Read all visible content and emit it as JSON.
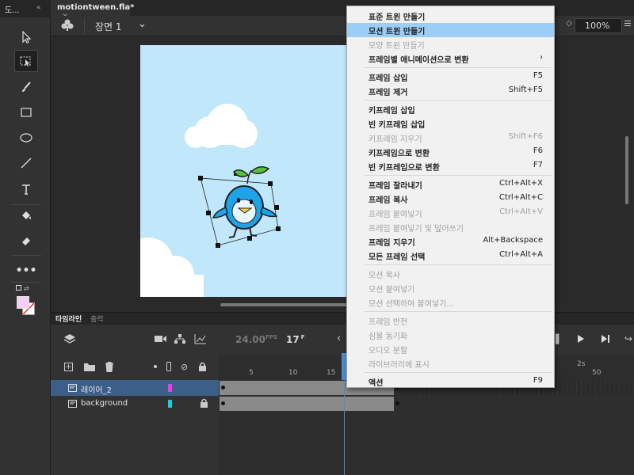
{
  "toolbar": {
    "panel_label": "도..."
  },
  "document": {
    "tab_title": "motiontween.fla*",
    "scene_label": "장면 1",
    "zoom": "100%"
  },
  "panels": {
    "tab_timeline": "타임라인",
    "tab_output": "출력"
  },
  "timeline": {
    "fps": "24.00",
    "fps_unit": "FPS",
    "current_frame": "17",
    "frame_unit": "F",
    "ruler": [
      "5",
      "10",
      "15",
      "2s",
      "50"
    ],
    "layers": [
      {
        "name": "레이어_2",
        "color": "#e442e4",
        "selected": true
      },
      {
        "name": "background",
        "color": "#1ccfe0",
        "selected": false
      }
    ]
  },
  "context_menu": {
    "items": [
      {
        "label": "표준 트윈 만들기",
        "shortcut": "",
        "disabled": false,
        "highlighted": false
      },
      {
        "label": "모션 트윈 만들기",
        "shortcut": "",
        "disabled": false,
        "highlighted": true
      },
      {
        "label": "모양 트윈 만들기",
        "shortcut": "",
        "disabled": true,
        "highlighted": false
      },
      {
        "label": "프레임별 애니메이션으로 변환",
        "shortcut": "›",
        "disabled": false,
        "highlighted": false,
        "sep_after": true
      },
      {
        "label": "프레임 삽입",
        "shortcut": "F5",
        "disabled": false,
        "highlighted": false
      },
      {
        "label": "프레임 제거",
        "shortcut": "Shift+F5",
        "disabled": false,
        "highlighted": false,
        "sep_after": true
      },
      {
        "label": "키프레임 삽입",
        "shortcut": "",
        "disabled": false,
        "highlighted": false
      },
      {
        "label": "빈 키프레임 삽입",
        "shortcut": "",
        "disabled": false,
        "highlighted": false
      },
      {
        "label": "키프레임 지우기",
        "shortcut": "Shift+F6",
        "disabled": true,
        "highlighted": false
      },
      {
        "label": "키프레임으로 변환",
        "shortcut": "F6",
        "disabled": false,
        "highlighted": false
      },
      {
        "label": "빈 키프레임으로 변환",
        "shortcut": "F7",
        "disabled": false,
        "highlighted": false,
        "sep_after": true
      },
      {
        "label": "프레임 잘라내기",
        "shortcut": "Ctrl+Alt+X",
        "disabled": false,
        "highlighted": false
      },
      {
        "label": "프레임 복사",
        "shortcut": "Ctrl+Alt+C",
        "disabled": false,
        "highlighted": false
      },
      {
        "label": "프레임 붙여넣기",
        "shortcut": "Ctrl+Alt+V",
        "disabled": true,
        "highlighted": false
      },
      {
        "label": "프레임 붙여넣기 및 덮어쓰기",
        "shortcut": "",
        "disabled": true,
        "highlighted": false
      },
      {
        "label": "프레임 지우기",
        "shortcut": "Alt+Backspace",
        "disabled": false,
        "highlighted": false
      },
      {
        "label": "모든 프레임 선택",
        "shortcut": "Ctrl+Alt+A",
        "disabled": false,
        "highlighted": false,
        "sep_after": true
      },
      {
        "label": "모션 복사",
        "shortcut": "",
        "disabled": true,
        "highlighted": false
      },
      {
        "label": "모션 붙여넣기",
        "shortcut": "",
        "disabled": true,
        "highlighted": false
      },
      {
        "label": "모션 선택하여 붙여넣기...",
        "shortcut": "",
        "disabled": true,
        "highlighted": false,
        "sep_after": true
      },
      {
        "label": "프레임 반전",
        "shortcut": "",
        "disabled": true,
        "highlighted": false
      },
      {
        "label": "심볼 동기화",
        "shortcut": "",
        "disabled": true,
        "highlighted": false
      },
      {
        "label": "오디오 분할",
        "shortcut": "",
        "disabled": true,
        "highlighted": false
      },
      {
        "label": "라이브러리에 표시",
        "shortcut": "",
        "disabled": true,
        "highlighted": false,
        "sep_after": true
      },
      {
        "label": "액션",
        "shortcut": "F9",
        "disabled": false,
        "highlighted": false
      }
    ]
  },
  "colors": {
    "highlight": "#9ccef5",
    "stage_bg": "#c1e7fa",
    "playhead": "#4b8ccb",
    "character_body": "#1ea3e8",
    "leaf": "#52c23c"
  }
}
